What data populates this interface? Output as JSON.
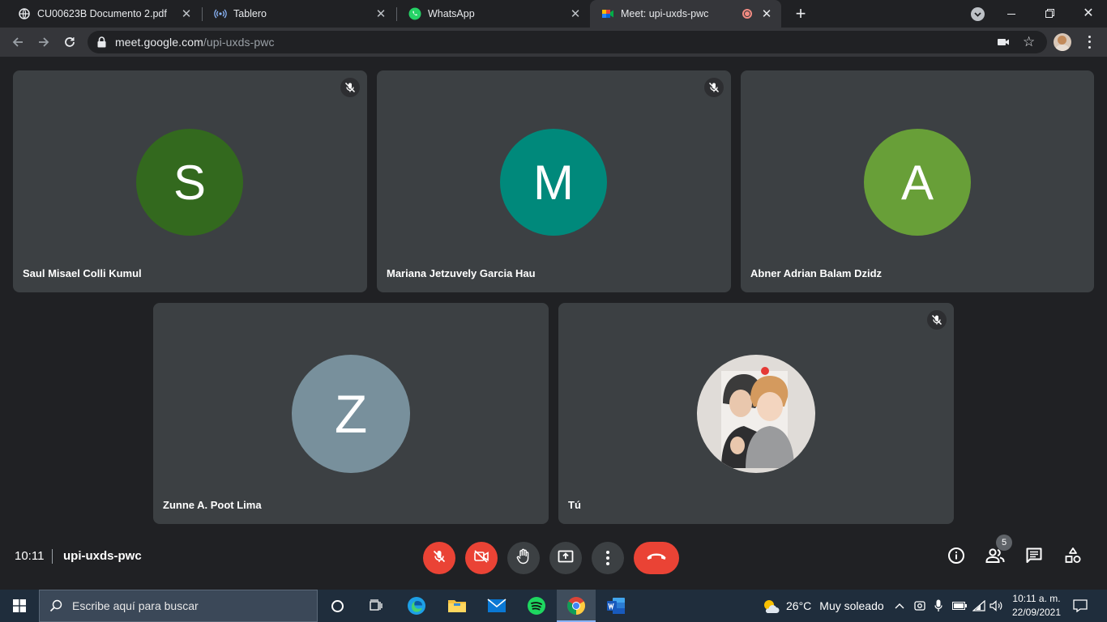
{
  "browser": {
    "tabs": [
      {
        "title": "CU00623B Documento 2.pdf",
        "icon": "globe-icon",
        "active": false
      },
      {
        "title": "Tablero",
        "icon": "broadcast-icon",
        "active": false
      },
      {
        "title": "WhatsApp",
        "icon": "whatsapp-icon",
        "active": false
      },
      {
        "title": "Meet: upi-uxds-pwc",
        "icon": "google-meet-icon",
        "active": true
      }
    ],
    "new_tab": "+",
    "url_host": "meet.google.com",
    "url_path": "/upi-uxds-pwc"
  },
  "meeting": {
    "participants": [
      {
        "initial": "S",
        "name": "Saul Misael Colli Kumul",
        "color": "#33691e",
        "muted": true
      },
      {
        "initial": "M",
        "name": "Mariana Jetzuvely Garcia Hau",
        "color": "#00897b",
        "muted": true
      },
      {
        "initial": "A",
        "name": "Abner Adrian Balam Dzidz",
        "color": "#689f38",
        "muted": false
      },
      {
        "initial": "Z",
        "name": "Zunne A. Poot Lima",
        "color": "#78909c",
        "muted": false
      },
      {
        "initial": "",
        "name": "Tú",
        "color": "#e0dcd8",
        "muted": true
      }
    ],
    "time": "10:11",
    "code": "upi-uxds-pwc",
    "people_count": "5"
  },
  "colors": {
    "accent_red": "#ea4335",
    "tile_bg": "#3c4043",
    "page_bg": "#202124"
  },
  "taskbar": {
    "search_placeholder": "Escribe aquí para buscar",
    "weather_temp": "26°C",
    "weather_text": "Muy soleado",
    "clock_time": "10:11 a. m.",
    "clock_date": "22/09/2021"
  }
}
